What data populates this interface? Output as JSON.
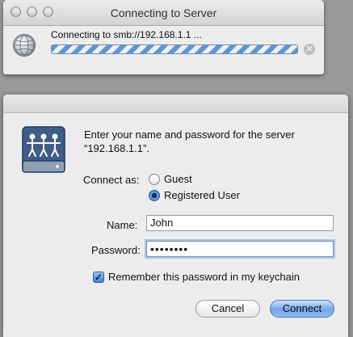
{
  "progress_window": {
    "title": "Connecting to Server",
    "status": "Connecting to smb://192.168.1.1 ...",
    "icons": {
      "server": "globe-icon",
      "stop": "stop-icon"
    },
    "stop_glyph": "✕"
  },
  "login_dialog": {
    "message_line1": "Enter your name and password for the server",
    "message_line2": "“192.168.1.1”.",
    "connect_as_label": "Connect as:",
    "options": {
      "guest": "Guest",
      "registered": "Registered User"
    },
    "selected_option": "Registered User",
    "name_label": "Name:",
    "name_value": "John",
    "password_label": "Password:",
    "password_value": "••••••••",
    "remember_label": "Remember this password in my keychain",
    "remember_checked": true,
    "check_glyph": "✓",
    "cancel_label": "Cancel",
    "connect_label": "Connect"
  },
  "colors": {
    "accent": "#3b7fd5",
    "progress_stripe": "#5b97d6"
  }
}
